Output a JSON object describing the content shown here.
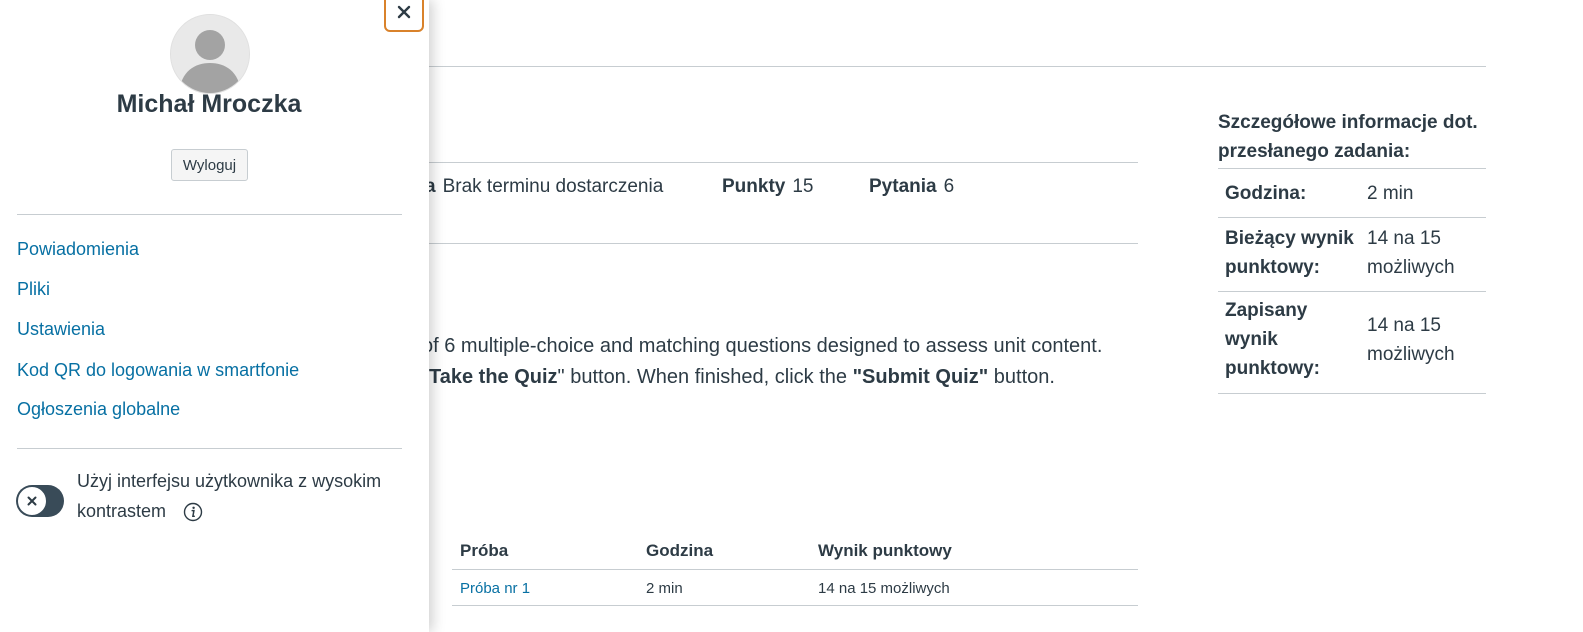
{
  "details": {
    "due_label": "a",
    "due_value": "Brak terminu dostarczenia",
    "points_label": "Punkty",
    "points_value": "15",
    "questions_label": "Pytania",
    "questions_value": "6"
  },
  "description": {
    "line1": "of 6 multiple-choice and matching questions designed to assess unit content.",
    "line2_take": "Take the Quiz",
    "line2_mid": "\" button. When finished, click the ",
    "line2_submit": "\"Submit Quiz\"",
    "line2_end": " button."
  },
  "history": {
    "headers": [
      "Próba",
      "Godzina",
      "Wynik punktowy"
    ],
    "rows": [
      {
        "attempt": "Próba nr 1",
        "time": "2 min",
        "score": "14 na 15 możliwych"
      }
    ]
  },
  "submission": {
    "title": "Szczegółowe informacje dot. przesłanego zadania:",
    "rows": [
      {
        "key": "Godzina:",
        "value": "2 min"
      },
      {
        "key": "Bieżący wynik punktowy:",
        "value": "14 na 15 możliwych"
      },
      {
        "key": "Zapisany wynik punktowy:",
        "value": "14 na 15 możliwych"
      }
    ]
  },
  "tray": {
    "close_icon": "close-icon",
    "user_name": "Michał Mroczka",
    "logout_label": "Wyloguj",
    "links": [
      "Powiadomienia",
      "Pliki",
      "Ustawienia",
      "Kod QR do logowania w smartfonie",
      "Ogłoszenia globalne"
    ],
    "high_contrast_label": "Użyj interfejsu użytkownika z wysokim kontrastem",
    "high_contrast_enabled": false
  },
  "colors": {
    "link": "#0770a3",
    "focus": "#d9822b",
    "text": "#2d3b45",
    "toggle": "#394b58"
  }
}
